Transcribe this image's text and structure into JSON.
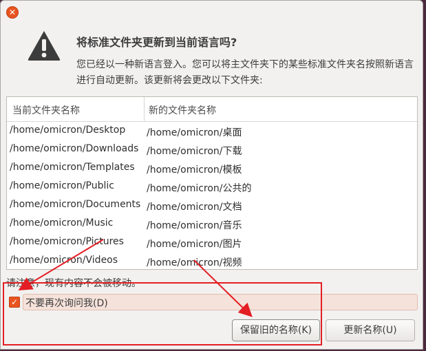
{
  "dialog": {
    "heading": "将标准文件夹更新到当前语言吗?",
    "description": "您已经以一种新语言登入。您可以将主文件夹下的某些标准文件夹名按照新语言进行自动更新。该更新将会更改以下文件夹:",
    "close_symbol": "✕"
  },
  "table": {
    "columns": [
      "当前文件夹名称",
      "新的文件夹名称"
    ],
    "rows": [
      {
        "current": "/home/omicron/Desktop",
        "new": "/home/omicron/桌面"
      },
      {
        "current": "/home/omicron/Downloads",
        "new": "/home/omicron/下载"
      },
      {
        "current": "/home/omicron/Templates",
        "new": "/home/omicron/模板"
      },
      {
        "current": "/home/omicron/Public",
        "new": "/home/omicron/公共的"
      },
      {
        "current": "/home/omicron/Documents",
        "new": "/home/omicron/文档"
      },
      {
        "current": "/home/omicron/Music",
        "new": "/home/omicron/音乐"
      },
      {
        "current": "/home/omicron/Pictures",
        "new": "/home/omicron/图片"
      },
      {
        "current": "/home/omicron/Videos",
        "new": "/home/omicron/视频"
      }
    ]
  },
  "note": "请注意，现有内容不会被移动。",
  "checkbox": {
    "label": "不要再次询问我(D)",
    "checked": true,
    "check_symbol": "✓"
  },
  "buttons": {
    "keep_old": "保留旧的名称(K)",
    "update": "更新名称(U)"
  },
  "colors": {
    "accent": "#e95420",
    "annotation": "#e31e24"
  },
  "icons": {
    "warning": "warning-icon",
    "close": "close-icon",
    "check": "check-icon"
  }
}
